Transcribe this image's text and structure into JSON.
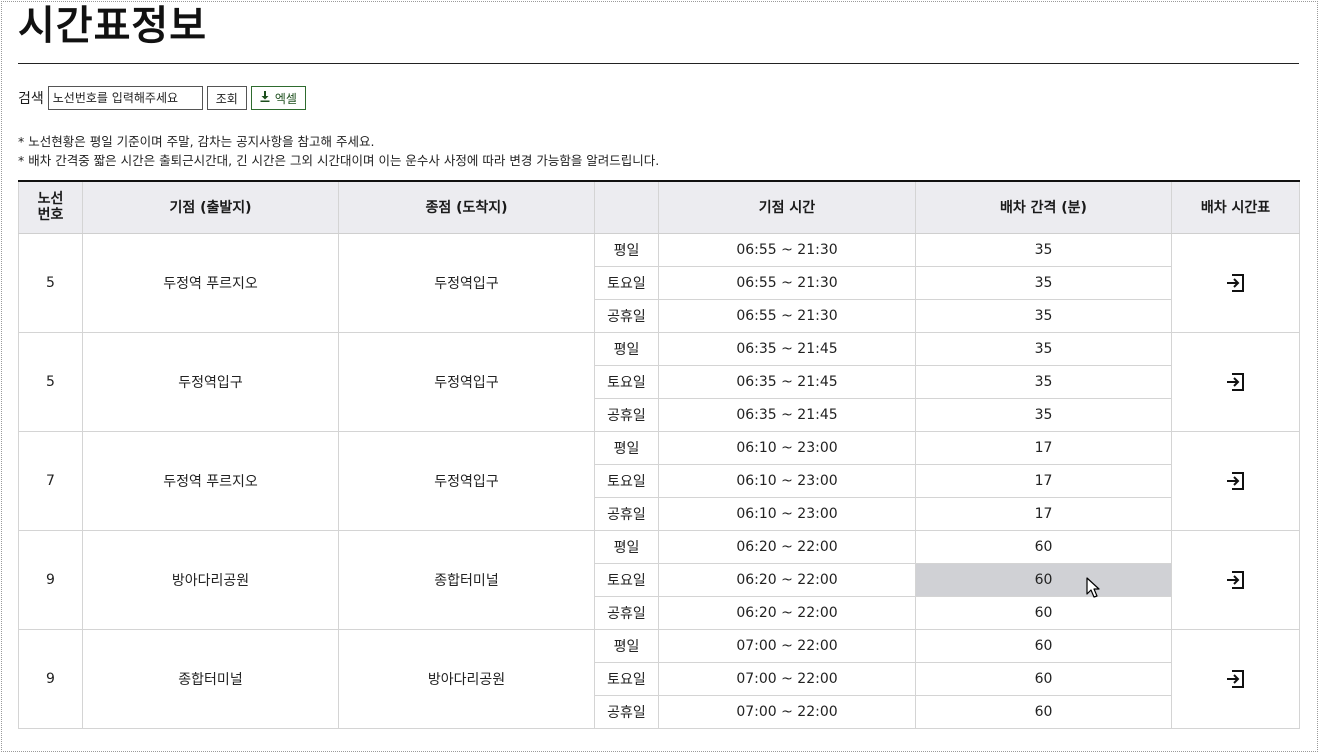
{
  "page": {
    "title": "시간표정보"
  },
  "search": {
    "label": "검색",
    "placeholder": "노선번호를 입력해주세요",
    "submit_label": "조회",
    "excel_label": "엑셀"
  },
  "notes": [
    "* 노선현황은 평일 기준이며 주말, 감차는 공지사항을 참고해 주세요.",
    "* 배차 간격중 짧은 시간은 출퇴근시간대, 긴 시간은 그외 시간대이며 이는 운수사 사정에 따라 변경 가능함을 알려드립니다."
  ],
  "table": {
    "headers": {
      "route_no": "노선\n번호",
      "origin": "기점 (출발지)",
      "terminus": "종점 (도착지)",
      "day": "",
      "time": "기점 시간",
      "interval": "배차 간격 (분)",
      "timetable": "배차 시간표"
    },
    "routes": [
      {
        "no": "5",
        "origin": "두정역 푸르지오",
        "terminus": "두정역입구",
        "rows": [
          {
            "day": "평일",
            "time": "06:55 ~ 21:30",
            "interval": "35"
          },
          {
            "day": "토요일",
            "time": "06:55 ~ 21:30",
            "interval": "35"
          },
          {
            "day": "공휴일",
            "time": "06:55 ~ 21:30",
            "interval": "35"
          }
        ]
      },
      {
        "no": "5",
        "origin": "두정역입구",
        "terminus": "두정역입구",
        "rows": [
          {
            "day": "평일",
            "time": "06:35 ~ 21:45",
            "interval": "35"
          },
          {
            "day": "토요일",
            "time": "06:35 ~ 21:45",
            "interval": "35"
          },
          {
            "day": "공휴일",
            "time": "06:35 ~ 21:45",
            "interval": "35"
          }
        ]
      },
      {
        "no": "7",
        "origin": "두정역 푸르지오",
        "terminus": "두정역입구",
        "rows": [
          {
            "day": "평일",
            "time": "06:10 ~ 23:00",
            "interval": "17"
          },
          {
            "day": "토요일",
            "time": "06:10 ~ 23:00",
            "interval": "17"
          },
          {
            "day": "공휴일",
            "time": "06:10 ~ 23:00",
            "interval": "17"
          }
        ]
      },
      {
        "no": "9",
        "origin": "방아다리공원",
        "terminus": "종합터미널",
        "rows": [
          {
            "day": "평일",
            "time": "06:20 ~ 22:00",
            "interval": "60"
          },
          {
            "day": "토요일",
            "time": "06:20 ~ 22:00",
            "interval": "60",
            "highlight": true
          },
          {
            "day": "공휴일",
            "time": "06:20 ~ 22:00",
            "interval": "60"
          }
        ]
      },
      {
        "no": "9",
        "origin": "종합터미널",
        "terminus": "방아다리공원",
        "rows": [
          {
            "day": "평일",
            "time": "07:00 ~ 22:00",
            "interval": "60"
          },
          {
            "day": "토요일",
            "time": "07:00 ~ 22:00",
            "interval": "60"
          },
          {
            "day": "공휴일",
            "time": "07:00 ~ 22:00",
            "interval": "60"
          }
        ]
      }
    ]
  },
  "icons": {
    "excel": "download-icon",
    "timetable": "exit-to-icon",
    "pointer": "mouse-cursor-icon"
  },
  "colors": {
    "header_bg": "#ececf0",
    "highlight_bg": "#d0d1d5",
    "excel_accent": "#1d4f1d"
  }
}
